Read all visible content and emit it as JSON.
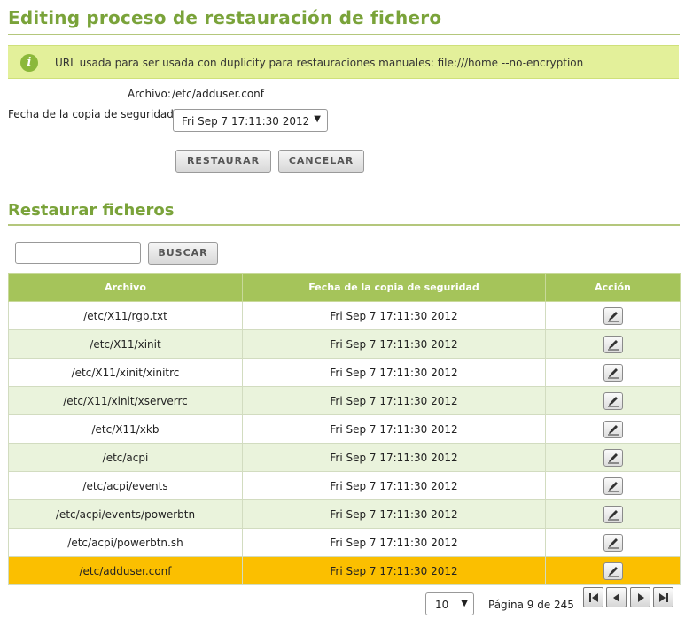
{
  "page": {
    "title": "Editing proceso de restauración de fichero"
  },
  "info": {
    "icon": "info-icon",
    "message": "URL usada para ser usada con duplicity para restauraciones manuales: file:///home --no-encryption"
  },
  "form": {
    "archivo_label": "Archivo:",
    "archivo_value": "/etc/adduser.conf",
    "fecha_label": "Fecha de la copia de seguridad:",
    "fecha_selected": "Fri Sep 7 17:11:30 2012",
    "restore_label": "RESTAURAR",
    "cancel_label": "CANCELAR"
  },
  "section": {
    "title": "Restaurar ficheros",
    "search_value": "",
    "search_button": "BUSCAR"
  },
  "table": {
    "columns": [
      "Archivo",
      "Fecha de la copia de seguridad",
      "Acción"
    ],
    "rows": [
      {
        "archivo": "/etc/X11/rgb.txt",
        "fecha": "Fri Sep 7 17:11:30 2012"
      },
      {
        "archivo": "/etc/X11/xinit",
        "fecha": "Fri Sep 7 17:11:30 2012"
      },
      {
        "archivo": "/etc/X11/xinit/xinitrc",
        "fecha": "Fri Sep 7 17:11:30 2012"
      },
      {
        "archivo": "/etc/X11/xinit/xserverrc",
        "fecha": "Fri Sep 7 17:11:30 2012"
      },
      {
        "archivo": "/etc/X11/xkb",
        "fecha": "Fri Sep 7 17:11:30 2012"
      },
      {
        "archivo": "/etc/acpi",
        "fecha": "Fri Sep 7 17:11:30 2012"
      },
      {
        "archivo": "/etc/acpi/events",
        "fecha": "Fri Sep 7 17:11:30 2012"
      },
      {
        "archivo": "/etc/acpi/events/powerbtn",
        "fecha": "Fri Sep 7 17:11:30 2012"
      },
      {
        "archivo": "/etc/acpi/powerbtn.sh",
        "fecha": "Fri Sep 7 17:11:30 2012"
      },
      {
        "archivo": "/etc/adduser.conf",
        "fecha": "Fri Sep 7 17:11:30 2012",
        "selected": true
      }
    ],
    "action_icon": "pencil-icon"
  },
  "pager": {
    "page_size": "10",
    "page_info": "Página 9 de 245",
    "buttons": [
      "first-page-icon",
      "previous-page-icon",
      "next-page-icon",
      "last-page-icon"
    ]
  },
  "colors": {
    "heading": "#7aa33a",
    "header_bg": "#a5c45a",
    "row_alt": "#eaf3dc",
    "row_selected": "#fbbf00",
    "info_bg": "#e3f09a"
  }
}
